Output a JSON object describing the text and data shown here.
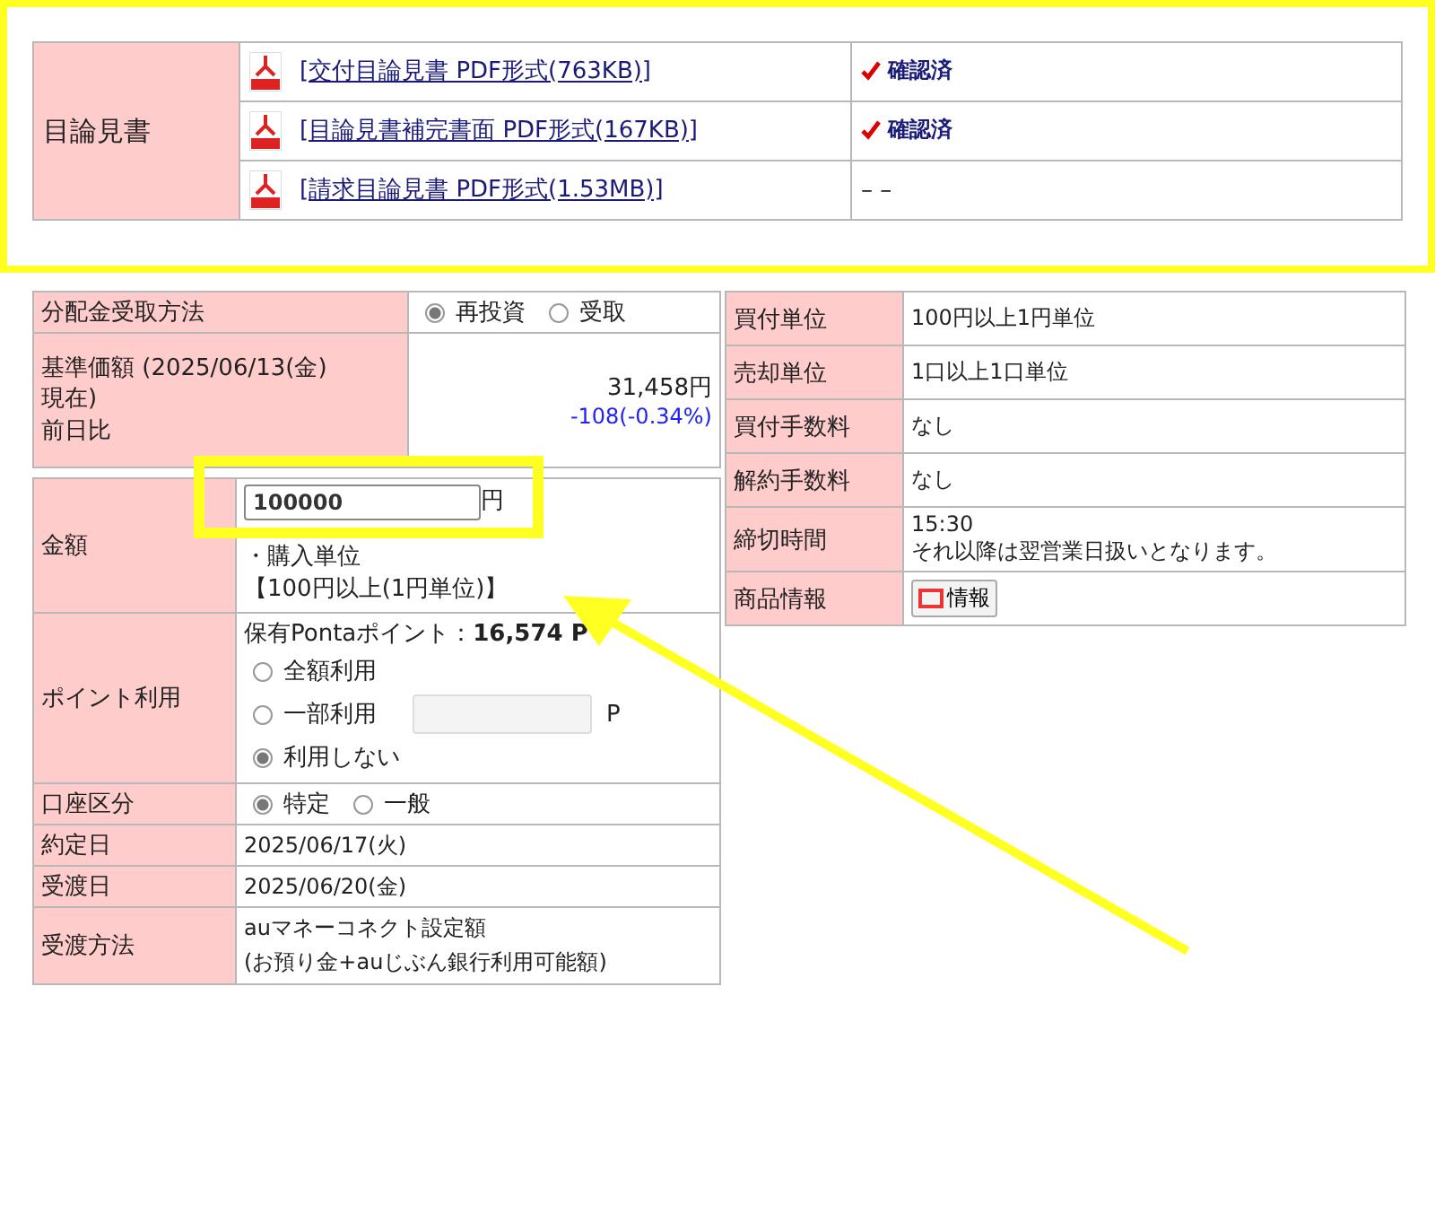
{
  "prospectus": {
    "label": "目論見書",
    "documents": [
      {
        "link": "[交付目論見書 PDF形式(763KB)]",
        "confirmed": true,
        "status": "確認済"
      },
      {
        "link": "[目論見書補完書面 PDF形式(167KB)]",
        "confirmed": true,
        "status": "確認済"
      },
      {
        "link": "[請求目論見書 PDF形式(1.53MB)]",
        "confirmed": false,
        "status": "– –"
      }
    ]
  },
  "distribution": {
    "label": "分配金受取方法",
    "options": [
      {
        "label": "再投資",
        "selected": true
      },
      {
        "label": "受取",
        "selected": false
      }
    ]
  },
  "base_price": {
    "label_lines": [
      "基準価額 (2025/06/13(金)",
      "現在)",
      "前日比"
    ],
    "price": "31,458円",
    "change": "-108(-0.34%)"
  },
  "order": {
    "amount": {
      "label": "金額",
      "value": "100000",
      "unit": "円",
      "note_title": "・購入単位",
      "note": "【100円以上(1円単位)】"
    },
    "points": {
      "label": "ポイント利用",
      "held_label": "保有Pontaポイント：",
      "held_value": "16,574 P",
      "options": [
        {
          "label": "全額利用",
          "selected": false,
          "kind": "plain"
        },
        {
          "label": "一部利用",
          "selected": false,
          "kind": "input",
          "unit": "P"
        },
        {
          "label": "利用しない",
          "selected": true,
          "kind": "plain"
        }
      ]
    },
    "account": {
      "label": "口座区分",
      "options": [
        {
          "label": "特定",
          "selected": true
        },
        {
          "label": "一般",
          "selected": false
        }
      ]
    },
    "rows": [
      {
        "label": "約定日",
        "value": "2025/06/17(火)"
      },
      {
        "label": "受渡日",
        "value": "2025/06/20(金)"
      }
    ],
    "settlement": {
      "label": "受渡方法",
      "lines": [
        "auマネーコネクト設定額",
        "(お預り金+auじぶん銀行利用可能額)"
      ]
    }
  },
  "product": {
    "rows": [
      {
        "label": "買付単位",
        "lines": [
          "100円以上1円単位"
        ]
      },
      {
        "label": "売却単位",
        "lines": [
          "1口以上1口単位"
        ]
      },
      {
        "label": "買付手数料",
        "lines": [
          "なし"
        ]
      },
      {
        "label": "解約手数料",
        "lines": [
          "なし"
        ]
      },
      {
        "label": "締切時間",
        "lines": [
          "15:30",
          "それ以降は翌営業日扱いとなります。"
        ]
      }
    ],
    "info": {
      "label": "商品情報",
      "button": "情報"
    }
  }
}
